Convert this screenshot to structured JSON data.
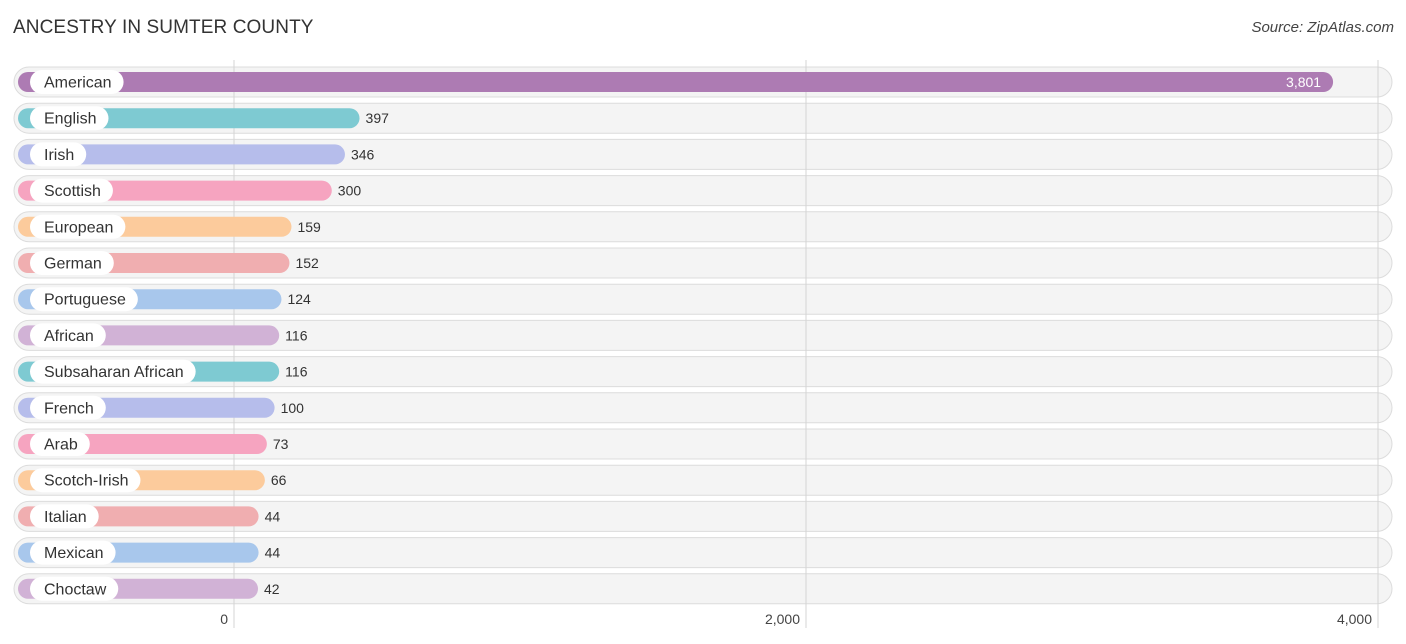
{
  "header": {
    "title": "ANCESTRY IN SUMTER COUNTY",
    "source": "Source: ZipAtlas.com"
  },
  "chart_data": {
    "type": "bar",
    "orientation": "horizontal",
    "title": "ANCESTRY IN SUMTER COUNTY",
    "source": "Source: ZipAtlas.com",
    "xlabel": "",
    "ylabel": "",
    "xlim": [
      0,
      4000
    ],
    "xticks": [
      0,
      2000,
      4000
    ],
    "xtick_labels": [
      "0",
      "2,000",
      "4,000"
    ],
    "grid": true,
    "categories": [
      "American",
      "English",
      "Irish",
      "Scottish",
      "European",
      "German",
      "Portuguese",
      "African",
      "Subsaharan African",
      "French",
      "Arab",
      "Scotch-Irish",
      "Italian",
      "Mexican",
      "Choctaw"
    ],
    "values": [
      3801,
      397,
      346,
      300,
      159,
      152,
      124,
      116,
      116,
      100,
      73,
      66,
      44,
      44,
      42
    ],
    "value_labels": [
      "3,801",
      "397",
      "346",
      "300",
      "159",
      "152",
      "124",
      "116",
      "116",
      "100",
      "73",
      "66",
      "44",
      "44",
      "42"
    ],
    "colors": [
      "#ad7bb3",
      "#7ecad2",
      "#b6bdeb",
      "#f6a4c0",
      "#fccb9c",
      "#f0aeb0",
      "#a8c7ec",
      "#d1b2d6",
      "#7ecad2",
      "#b6bdeb",
      "#f6a4c0",
      "#fccb9c",
      "#f0aeb0",
      "#a8c7ec",
      "#d1b2d6"
    ]
  }
}
